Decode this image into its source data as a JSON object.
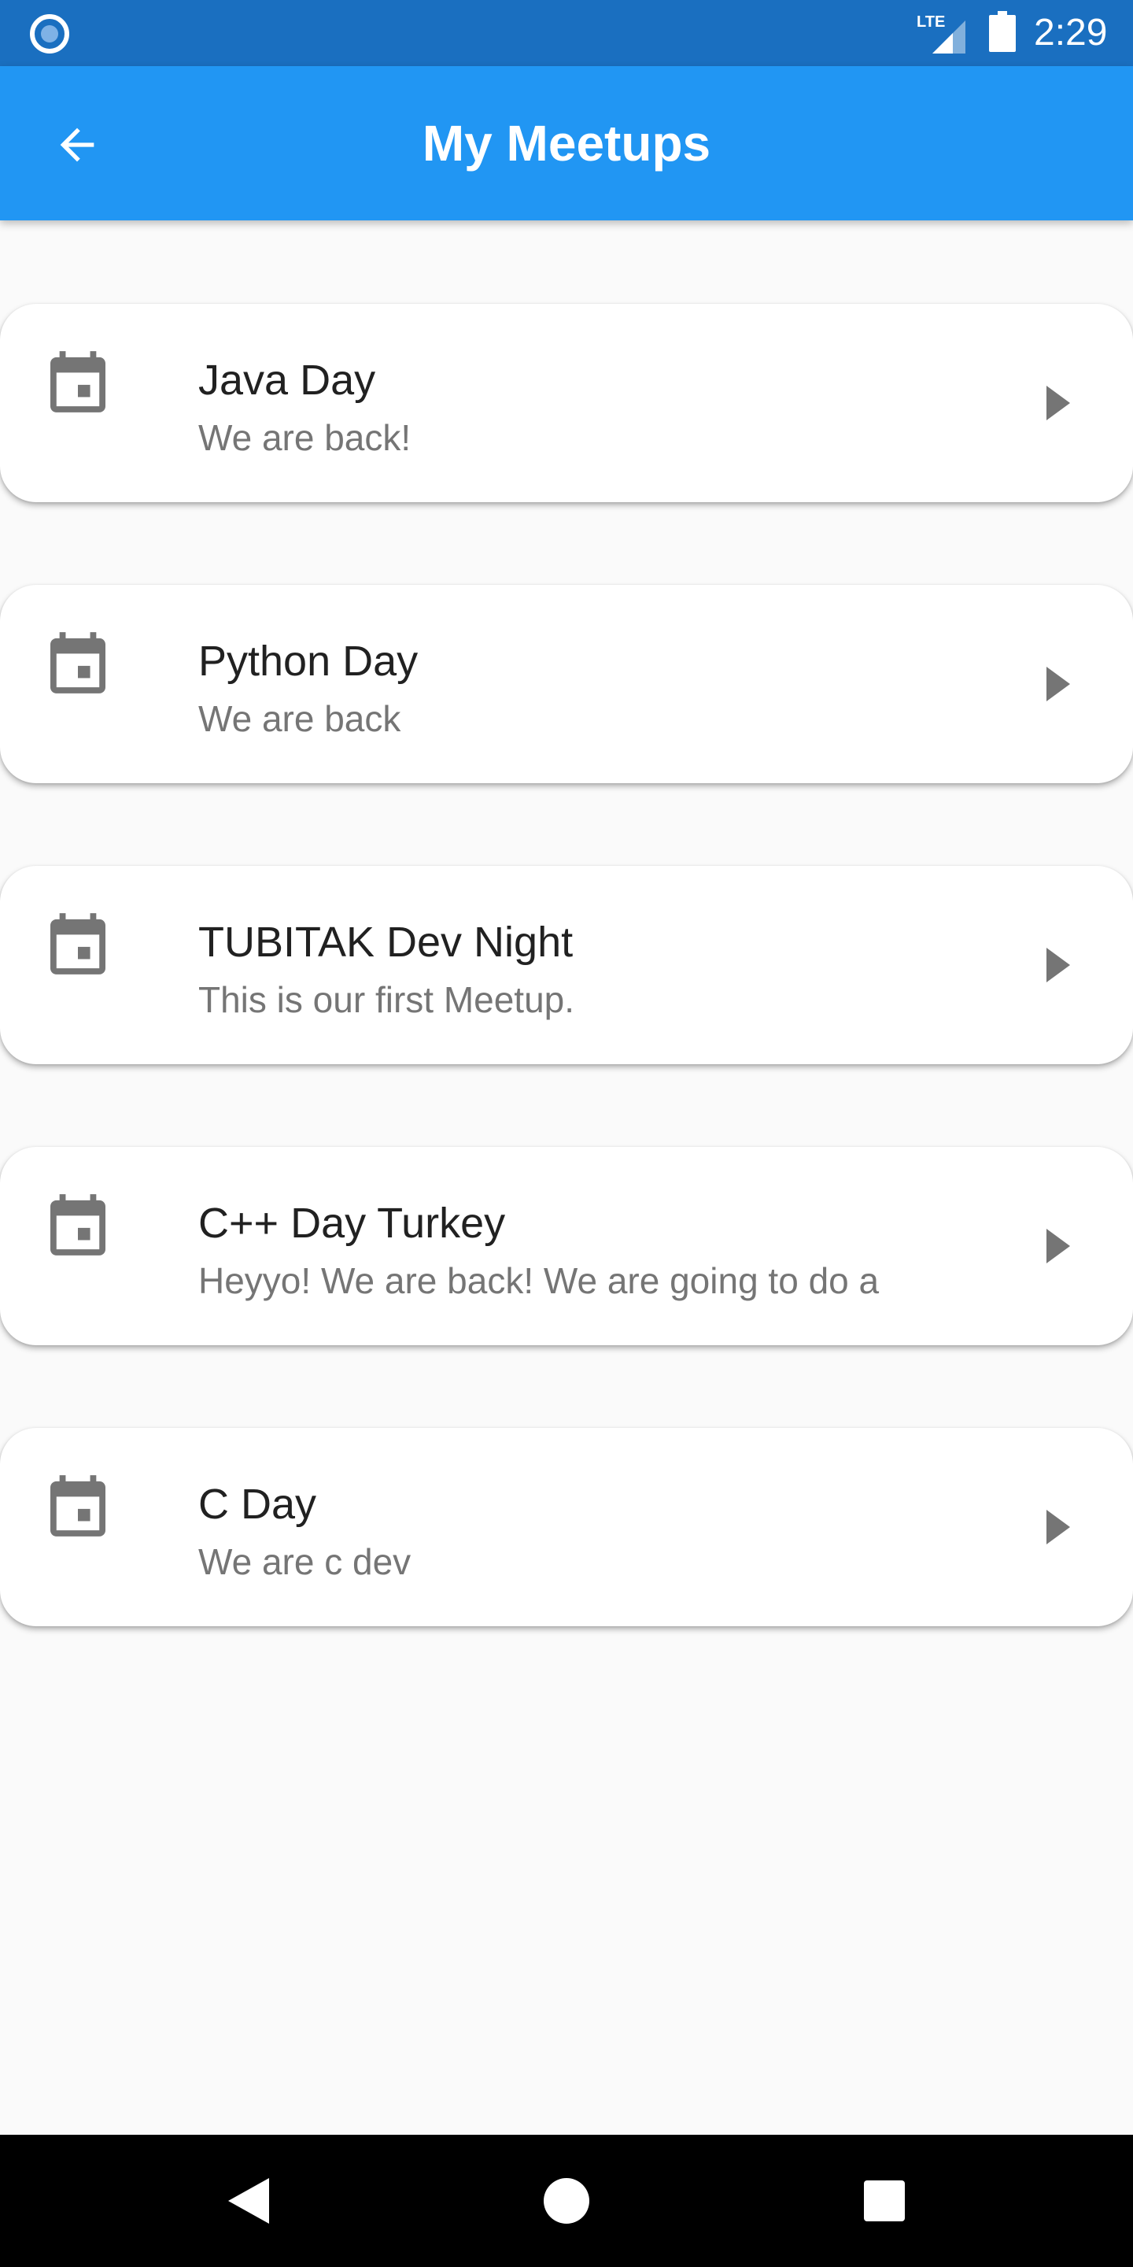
{
  "status_bar": {
    "network_label": "LTE",
    "time": "2:29"
  },
  "app_bar": {
    "title": "My Meetups",
    "back_icon": "arrow-back-icon",
    "color": "#2196f3"
  },
  "meetups": [
    {
      "title": "Java Day",
      "subtitle": "We are back!"
    },
    {
      "title": "Python Day",
      "subtitle": "We are back"
    },
    {
      "title": "TUBITAK Dev Night",
      "subtitle": "This is our first Meetup."
    },
    {
      "title": "C++ Day Turkey",
      "subtitle": "Heyyo! We are back! We are going to do a"
    },
    {
      "title": "C Day",
      "subtitle": "We are c dev"
    }
  ],
  "icons": {
    "leading": "calendar-icon",
    "trailing": "chevron-right-icon"
  },
  "nav_bar": {
    "buttons": [
      "back-triangle-icon",
      "home-circle-icon",
      "recents-square-icon"
    ]
  }
}
